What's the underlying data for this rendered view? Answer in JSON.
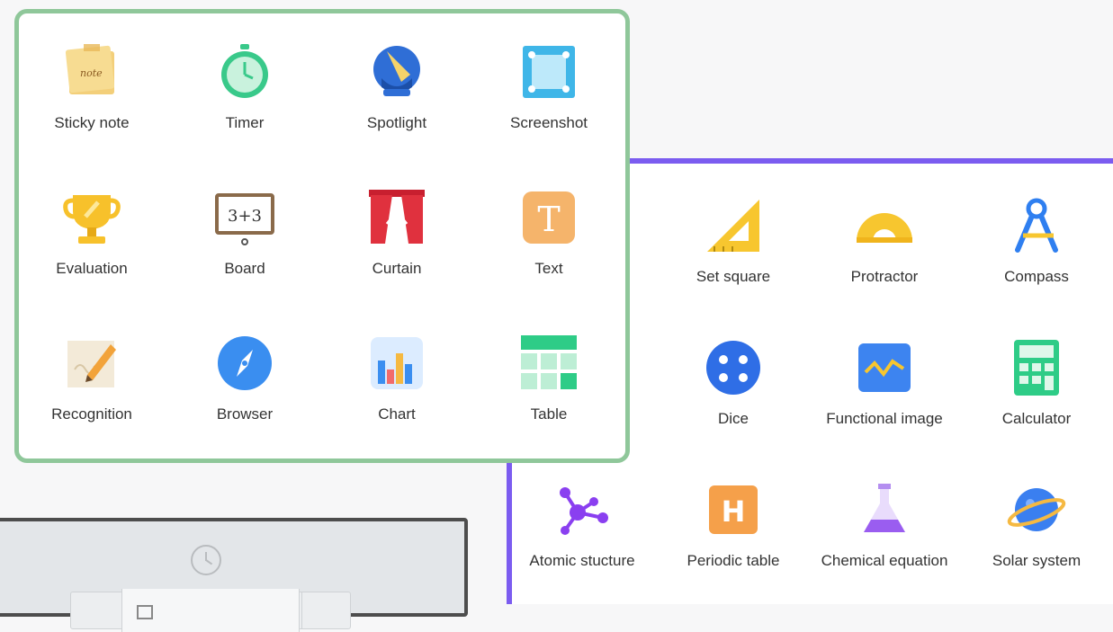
{
  "tools_panel": {
    "items": [
      {
        "label": "Sticky note",
        "icon": "sticky-note-icon"
      },
      {
        "label": "Timer",
        "icon": "timer-icon"
      },
      {
        "label": "Spotlight",
        "icon": "spotlight-icon"
      },
      {
        "label": "Screenshot",
        "icon": "screenshot-icon"
      },
      {
        "label": "Evaluation",
        "icon": "evaluation-trophy-icon"
      },
      {
        "label": "Board",
        "icon": "board-icon",
        "board_text": "3+3"
      },
      {
        "label": "Curtain",
        "icon": "curtain-icon"
      },
      {
        "label": "Text",
        "icon": "text-icon",
        "glyph": "T"
      },
      {
        "label": "Recognition",
        "icon": "recognition-icon"
      },
      {
        "label": "Browser",
        "icon": "browser-compass-icon"
      },
      {
        "label": "Chart",
        "icon": "chart-icon"
      },
      {
        "label": "Table",
        "icon": "table-icon"
      }
    ]
  },
  "subject_panel": {
    "items": [
      {
        "label": "Set square",
        "icon": "set-square-icon"
      },
      {
        "label": "Protractor",
        "icon": "protractor-icon"
      },
      {
        "label": "Compass",
        "icon": "compass-icon"
      },
      {
        "label": "Dice",
        "icon": "dice-icon"
      },
      {
        "label": "Functional image",
        "icon": "function-graph-icon"
      },
      {
        "label": "Calculator",
        "icon": "calculator-icon"
      },
      {
        "label": "Atomic stucture",
        "icon": "atomic-structure-icon"
      },
      {
        "label": "Periodic table",
        "icon": "periodic-table-icon",
        "glyph": "H"
      },
      {
        "label": "Chemical equation",
        "icon": "chemistry-flask-icon"
      },
      {
        "label": "Solar system",
        "icon": "planet-icon"
      }
    ]
  },
  "colors": {
    "green_border": "#8fc79a",
    "purple_border": "#7b5cf0",
    "window_border": "#4d4d4d"
  }
}
